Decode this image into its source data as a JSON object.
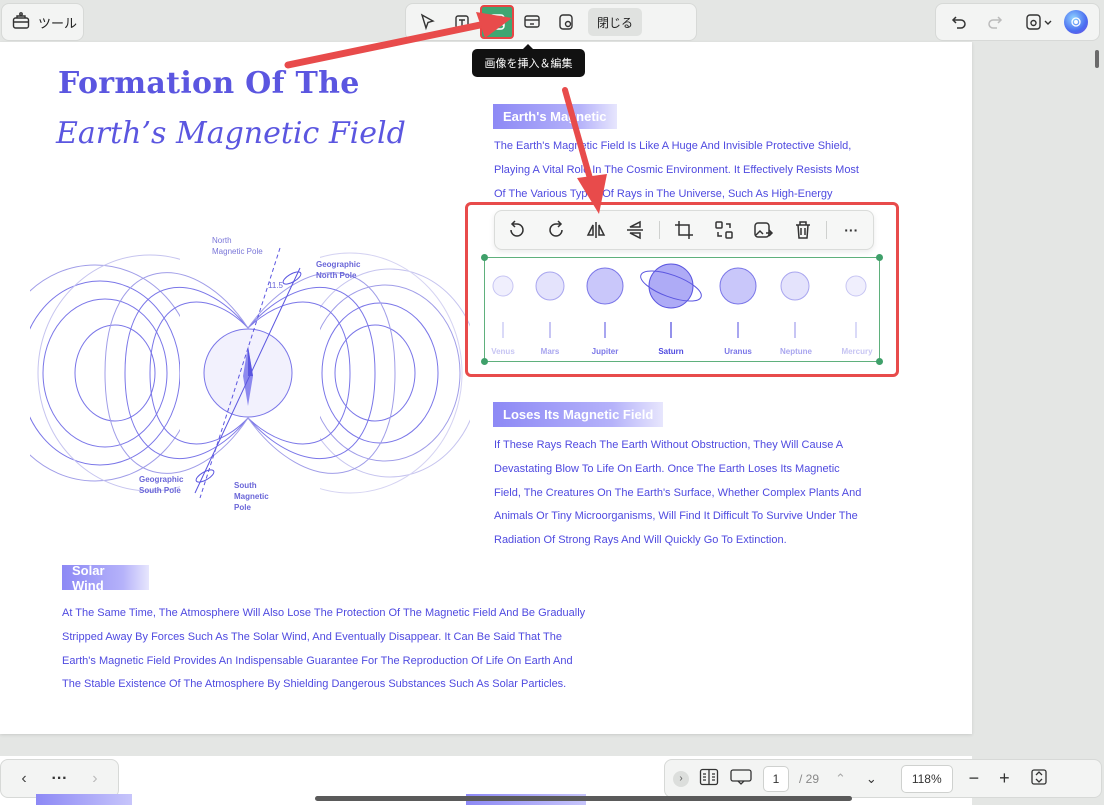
{
  "toolbar": {
    "tools_label": "ツール",
    "close_label": "閉じる",
    "tooltip": "画像を挿入＆編集"
  },
  "doc": {
    "title_line1": "Formation Of The",
    "title_line2": "Earth’s Magnetic Field",
    "diagram": {
      "north_magnetic_pole_line1": "North",
      "north_magnetic_pole_line2": "Magnetic Pole",
      "geographic_north_line1": "Geographic",
      "geographic_north_line2": "North Pole",
      "angle": "11.5",
      "geographic_south_line1": "Geographic",
      "geographic_south_line2": "South Pole",
      "south_magnetic_line1": "South",
      "south_magnetic_line2": "Magnetic",
      "south_magnetic_line3": "Pole"
    },
    "section1": {
      "tag": "Earth's Magnetic",
      "lines": [
        "The Earth's Magnetic Field Is Like A Huge And Invisible Protective Shield,",
        "Playing A Vital Role In The Cosmic Environment. It Effectively Resists Most",
        "Of The Various Types Of Rays in The Universe, Such As High-Energy"
      ]
    },
    "planets": [
      "Venus",
      "Mars",
      "Jupiter",
      "Saturn",
      "Uranus",
      "Neptune",
      "Mercury"
    ],
    "section2": {
      "tag": "Loses Its Magnetic Field",
      "lines": [
        "If These Rays Reach The Earth Without Obstruction, They Will Cause A",
        "Devastating Blow To Life On Earth. Once The Earth Loses Its Magnetic",
        "Field, The Creatures On The Earth's Surface, Whether Complex Plants And",
        "Animals Or Tiny Microorganisms, Will Find It Difficult To Survive Under The",
        "Radiation Of Strong Rays And Will Quickly Go To Extinction."
      ]
    },
    "section3": {
      "tag": "Solar Wind",
      "lines": [
        "At The Same Time, The Atmosphere Will Also Lose The Protection Of The Magnetic Field And Be Gradually",
        "Stripped Away By Forces Such As The Solar Wind, And Eventually Disappear. It Can Be Said That The",
        "Earth's Magnetic Field Provides An Indispensable Guarantee For The Reproduction Of Life On Earth And",
        "The Stable Existence Of The Atmosphere By Shielding Dangerous Substances Such As Solar Particles."
      ]
    }
  },
  "nav": {
    "more_label": "···",
    "current_page": "1",
    "total_pages": "/ 29",
    "zoom": "118%"
  },
  "colors": {
    "accent": "#5b56e0",
    "active_green": "#3fa672",
    "highlight_red": "#e84545"
  }
}
